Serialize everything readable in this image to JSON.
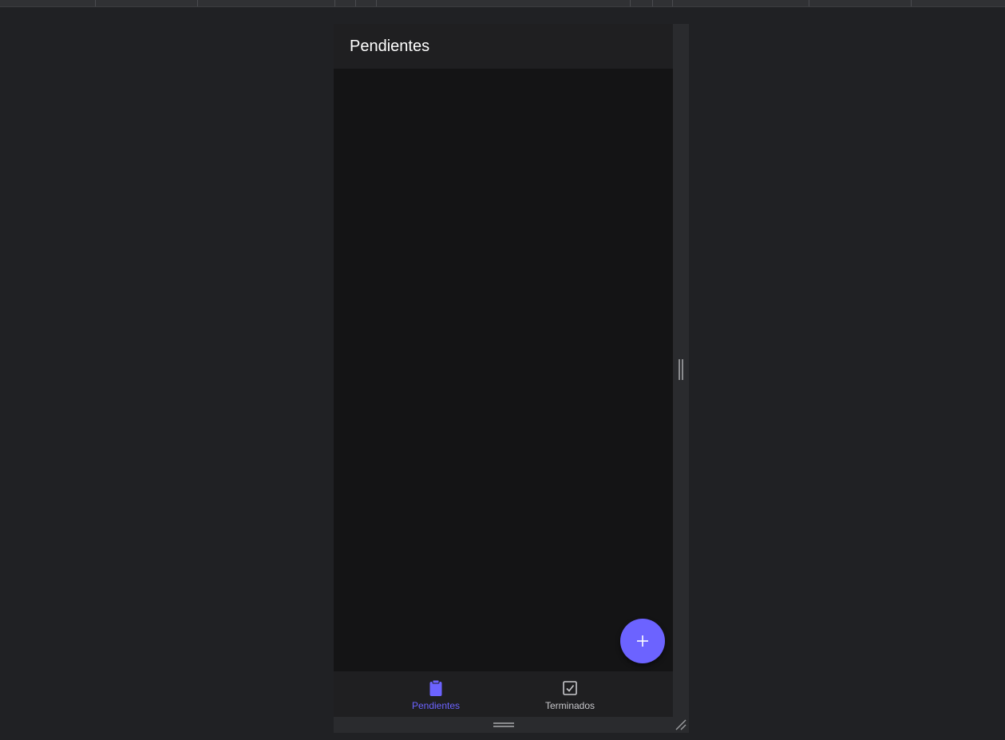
{
  "app": {
    "title": "Pendientes"
  },
  "fab": {
    "icon": "plus-icon",
    "color": "#6c63ff"
  },
  "bottom_nav": {
    "items": [
      {
        "label": "Pendientes",
        "icon": "clipboard-icon",
        "active": true
      },
      {
        "label": "Terminados",
        "icon": "checkbox-icon",
        "active": false
      }
    ],
    "active_color": "#6c63ff"
  }
}
